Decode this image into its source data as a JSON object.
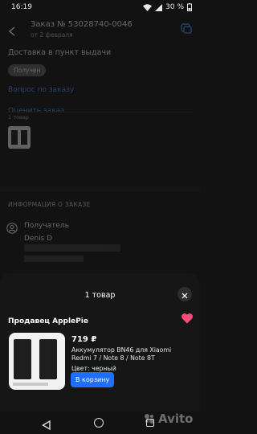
{
  "status_bar": {
    "time": "16:19",
    "battery": "30 %"
  },
  "header": {
    "order_title": "Заказ № 53028740-0046",
    "order_date": "от 2 февраля"
  },
  "delivery": {
    "label": "Доставка в пункт выдачи",
    "status": "Получен"
  },
  "links": {
    "question": "Вопрос по заказу",
    "rate": "Оценить заказ"
  },
  "order_items_card": {
    "count": "1 товар"
  },
  "info": {
    "heading": "ИНФОРМАЦИЯ О ЗАКАЗЕ",
    "recipient_label": "Получатель",
    "recipient_name": "Denis D"
  },
  "sheet": {
    "title": "1 товар",
    "seller": "Продавец ApplePie",
    "product": {
      "price": "719 ₽",
      "name": "Аккумулятор BN46 для Xiaomi Redmi 7 / Note 8 / Note 8T",
      "color": "Цвет: черный",
      "cart_button": "В корзину"
    }
  },
  "watermark": {
    "text": "Avito"
  },
  "colors": {
    "accent": "#1e6fff",
    "link": "#4a9cff",
    "heart": "#ff4d7a",
    "background": "#121212"
  },
  "icons": [
    "back-arrow-icon",
    "chat-icon",
    "person-icon",
    "close-icon",
    "heart-icon",
    "nav-back-icon",
    "nav-home-icon",
    "nav-recents-icon"
  ]
}
